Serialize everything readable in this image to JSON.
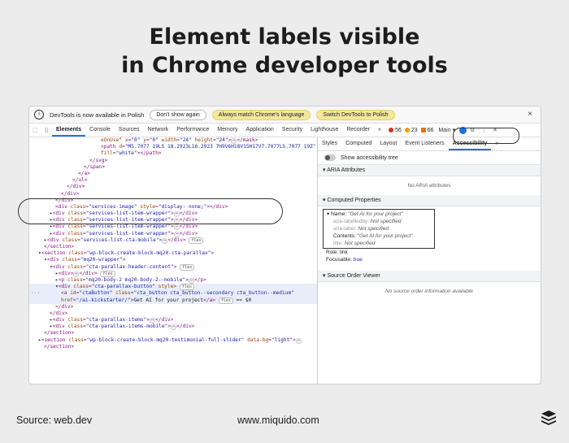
{
  "headline": {
    "line1": "Element labels visible",
    "line2": "in Chrome developer tools"
  },
  "infobar": {
    "text": "DevTools is now available in Polish",
    "btn_dont_show": "Don't show again",
    "btn_match": "Always match Chrome's language",
    "btn_switch": "Switch DevTools to Polish",
    "close": "×"
  },
  "tabs": [
    "Elements",
    "Console",
    "Sources",
    "Network",
    "Performance",
    "Memory",
    "Application",
    "Security",
    "Lighthouse",
    "Recorder"
  ],
  "toolbar": {
    "more": "»",
    "errors": "56",
    "warnings": "23",
    "issues": "66",
    "main": "Main ▾"
  },
  "code_lines": [
    {
      "indent": 12,
      "html": "<span class='a'>eOnUse</span><span class='x'>\"</span> <span class='a'>x</span>=<span class='v'>\"0\"</span> <span class='a'>y</span>=<span class='v'>\"0\"</span> <span class='a'>width</span>=<span class='v'>\"24\"</span> <span class='a'>height</span>=<span class='v'>\"24\"</span>&gt;<span class='ellip'>⋯</span>&lt;/mask&gt;"
    },
    {
      "indent": 12,
      "html": "&lt;path <span class='a'>d</span>=<span class='v'>\"M5.7077 19L5 18.2923L16.2923 7H9V6H18V15H17V7.7077L5.7077 19Z\"</span>"
    },
    {
      "indent": 12,
      "html": "<span class='a'>fill</span>=<span class='v'>\"white\"</span>&gt;&lt;/path&gt;"
    },
    {
      "indent": 10,
      "html": "&lt;/svg&gt;"
    },
    {
      "indent": 9,
      "html": "&lt;/span&gt;"
    },
    {
      "indent": 8,
      "html": "&lt;/a&gt;"
    },
    {
      "indent": 7,
      "html": "&lt;/ul&gt;"
    },
    {
      "indent": 6,
      "html": "&lt;/div&gt;"
    },
    {
      "indent": 5,
      "html": "&lt;/div&gt;"
    },
    {
      "indent": 4,
      "html": "&lt;/div&gt;"
    },
    {
      "indent": 4,
      "html": "&lt;div <span class='a'>class</span>=<span class='v'>\"services-image\"</span> <span class='a'>style</span>=<span class='v'>\"display: none;\"</span>&gt;&lt;/div&gt;"
    },
    {
      "indent": 3,
      "html": "<span class='x'>▸</span>&lt;div <span class='a'>class</span>=<span class='v'>\"services-list-item-wrapper\"</span>&gt;<span class='ellip'>⋯</span>&lt;/div&gt;"
    },
    {
      "indent": 3,
      "html": "<span class='x'>▸</span>&lt;div <span class='a'>class</span>=<span class='v'>\"services-list-item-wrapper\"</span>&gt;<span class='ellip'>⋯</span>&lt;/div&gt;"
    },
    {
      "indent": 3,
      "html": "<span class='x'>▸</span>&lt;div <span class='a'>class</span>=<span class='v'>\"services-list-item-wrapper\"</span>&gt;<span class='ellip'>⋯</span>&lt;/div&gt;"
    },
    {
      "indent": 3,
      "html": "<span class='x'>▸</span>&lt;div <span class='a'>class</span>=<span class='v'>\"services-list-item-wrapper\"</span>&gt;<span class='ellip'>⋯</span>&lt;/div&gt;"
    },
    {
      "indent": 2,
      "html": "<span class='x'>▸</span>&lt;div <span class='a'>class</span>=<span class='v'>\"services-list-cta-mobile\"</span>&gt;<span class='ellip'>⋯</span>&lt;/div&gt; <span class='flex'>flex</span>"
    },
    {
      "indent": 2,
      "html": "&lt;/section&gt;"
    },
    {
      "indent": 1,
      "html": "<span class='x'>▾</span>&lt;section <span class='a'>class</span>=<span class='v'>\"wp-block-create-block-mq20-cta-parallax\"</span>&gt;"
    },
    {
      "indent": 2,
      "html": "<span class='x'>▾</span>&lt;div <span class='a'>class</span>=<span class='v'>\"mq20-wrapper\"</span>&gt;"
    },
    {
      "indent": 3,
      "html": "<span class='x'>▾</span>&lt;div <span class='a'>class</span>=<span class='v'>\"cta-parallax-header-content\"</span>&gt; <span class='flex'>flex</span>"
    },
    {
      "indent": 4,
      "html": "<span class='x'>▸</span>&lt;div&gt;<span class='ellip'>⋯</span>&lt;/div&gt; <span class='flex'>flex</span>"
    },
    {
      "indent": 4,
      "html": "<span class='x'>▸</span>&lt;p <span class='a'>class</span>=<span class='v'>\"mq20-body-2 mq20-body-2--mobile\"</span>&gt;<span class='ellip'>⋯</span>&lt;/p&gt;"
    },
    {
      "indent": 4,
      "html": "<span class='x'>▾</span>&lt;div <span class='a'>class</span>=<span class='v'>\"cta-parallax-button\"</span> <span class='a'>style</span>&gt; <span class='flex'>flex</span>",
      "sel": true
    },
    {
      "indent": 5,
      "html": "&lt;a <span class='a'>id</span>=<span class='v'>\"ctaButton\"</span> <span class='a'>class</span>=<span class='v'>\"cta_button cta_button--secondary cta_button--medium\"</span>",
      "sel": true,
      "gutter": "···"
    },
    {
      "indent": 5,
      "html": "<span class='a'>href</span>=<span class='v'>\"/ai-kickstarter/\"</span>&gt;<span class='x'>Get AI for your project</span>&lt;/a&gt; <span class='flex'>flex</span> <span class='x'>== $0</span>",
      "sel": true
    },
    {
      "indent": 4,
      "html": "&lt;/div&gt;"
    },
    {
      "indent": 3,
      "html": "&lt;/div&gt;"
    },
    {
      "indent": 3,
      "html": "<span class='x'>▸</span>&lt;div <span class='a'>class</span>=<span class='v'>\"cta-parallax-items\"</span>&gt;<span class='ellip'>⋯</span>&lt;/div&gt;"
    },
    {
      "indent": 3,
      "html": "<span class='x'>▸</span>&lt;div <span class='a'>class</span>=<span class='v'>\"cta-parallax-items-mobile\"</span>&gt;<span class='ellip'>⋯</span>&lt;/div&gt;"
    },
    {
      "indent": 2,
      "html": "&lt;/section&gt;"
    },
    {
      "indent": 1,
      "html": "<span class='x'>▸</span>&lt;section <span class='a'>class</span>=<span class='v'>\"wp-block-create-block-mq20-testimonial-full-slider\"</span> <span class='a'>data-bg</span>=<span class='v'>\"light\"</span>&gt;<span class='ellip'>⋯</span>"
    },
    {
      "indent": 2,
      "html": "&lt;/section&gt;"
    }
  ],
  "right_tabs": [
    "Styles",
    "Computed",
    "Layout",
    "Event Listeners",
    "Accessibility"
  ],
  "right_more": "»",
  "accessibility_tree_label": "Show accessibility tree",
  "aria": {
    "header": "ARIA Attributes",
    "empty": "No ARIA attributes"
  },
  "computed": {
    "header": "Computed Properties",
    "name_label": "Name:",
    "name_value": "\"Get AI for your project\"",
    "labelledby_key": "aria-labelledby:",
    "labelledby_val": "Not specified",
    "label_key": "aria-label:",
    "label_val": "Not specified",
    "contents_key": "Contents:",
    "contents_val": "\"Get AI for your project\"",
    "title_key": "title:",
    "title_val": "Not specified",
    "role_key": "Role:",
    "role_val": "link",
    "focusable_key": "Focusable:",
    "focusable_val": "true"
  },
  "source_order": {
    "header": "Source Order Viewer",
    "empty": "No source order information available"
  },
  "footer": {
    "source": "Source: web.dev",
    "site": "www.miquido.com"
  },
  "colors": {
    "accent": "#1a73e8",
    "pill": "#f3e79a"
  }
}
